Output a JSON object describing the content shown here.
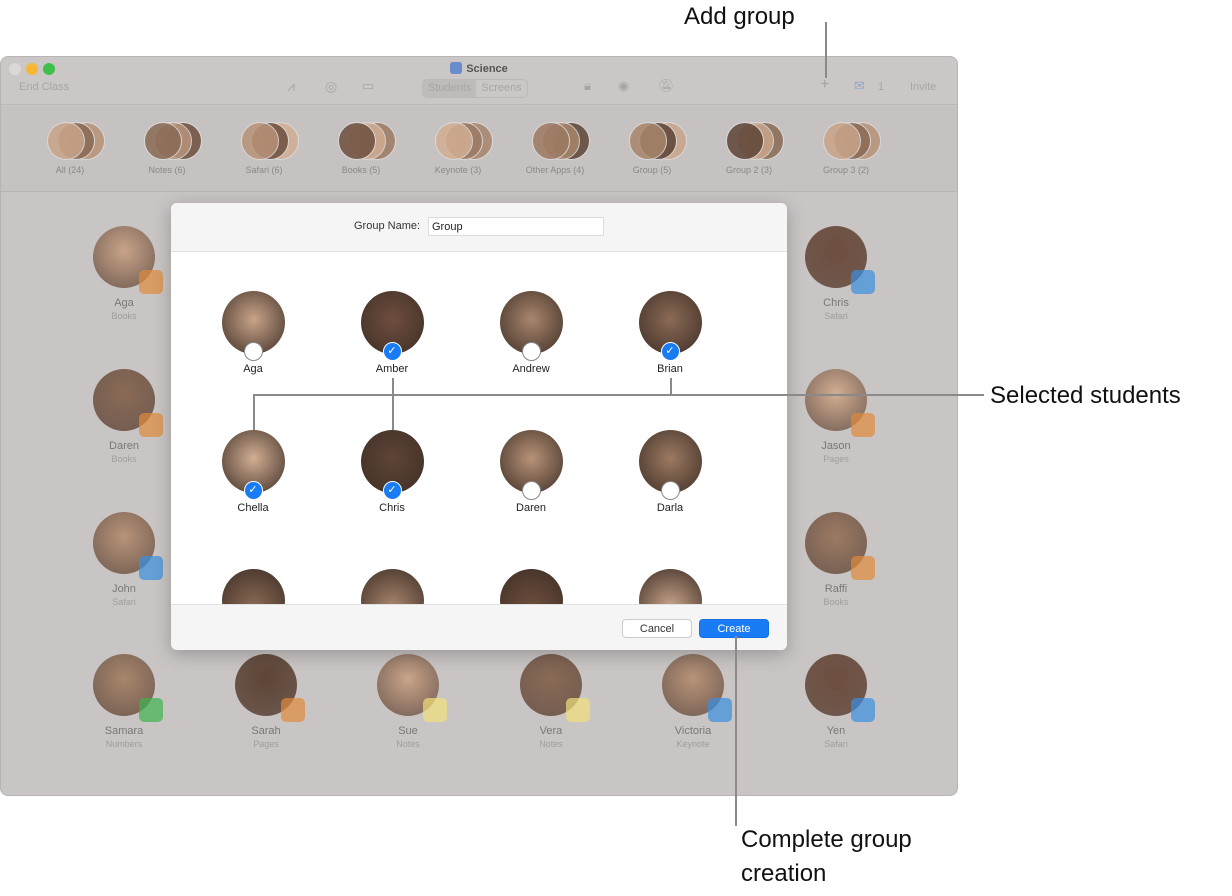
{
  "window": {
    "title": "Science",
    "toolbar": {
      "end_class": "End Class",
      "students_tab": "Students",
      "screens_tab": "Screens",
      "inbox_count": "1",
      "invite": "Invite"
    }
  },
  "groups": [
    {
      "label": "All (24)"
    },
    {
      "label": "Notes (6)"
    },
    {
      "label": "Safari (6)"
    },
    {
      "label": "Books (5)"
    },
    {
      "label": "Keynote (3)"
    },
    {
      "label": "Other Apps (4)"
    },
    {
      "label": "Group (5)"
    },
    {
      "label": "Group 2 (3)"
    },
    {
      "label": "Group 3 (2)"
    }
  ],
  "background_students": [
    {
      "name": "Aga",
      "app": "Books",
      "color": "#e08a3c"
    },
    {
      "name": "Daren",
      "app": "Books",
      "color": "#e08a3c"
    },
    {
      "name": "John",
      "app": "Safari",
      "color": "#3b8ee0"
    },
    {
      "name": "Chris",
      "app": "Safari",
      "color": "#3b8ee0"
    },
    {
      "name": "Jason",
      "app": "Pages",
      "color": "#e08a3c"
    },
    {
      "name": "Raffi",
      "app": "Books",
      "color": "#e08a3c"
    },
    {
      "name": "Samara",
      "app": "Numbers",
      "color": "#3fb34f"
    },
    {
      "name": "Sarah",
      "app": "Pages",
      "color": "#e08a3c"
    },
    {
      "name": "Sue",
      "app": "Notes",
      "color": "#f2e07a"
    },
    {
      "name": "Vera",
      "app": "Notes",
      "color": "#f2e07a"
    },
    {
      "name": "Victoria",
      "app": "Keynote",
      "color": "#3b8ee0"
    },
    {
      "name": "Yen",
      "app": "Safari",
      "color": "#3b8ee0"
    }
  ],
  "dialog": {
    "group_name_label": "Group Name:",
    "group_name_value": "Group",
    "cancel": "Cancel",
    "create": "Create",
    "students": [
      {
        "name": "Aga",
        "selected": false
      },
      {
        "name": "Amber",
        "selected": true
      },
      {
        "name": "Andrew",
        "selected": false
      },
      {
        "name": "Brian",
        "selected": true
      },
      {
        "name": "Chella",
        "selected": true
      },
      {
        "name": "Chris",
        "selected": true
      },
      {
        "name": "Daren",
        "selected": false
      },
      {
        "name": "Darla",
        "selected": false
      }
    ]
  },
  "callouts": {
    "add_group": "Add group",
    "selected_students": "Selected students",
    "complete": "Complete group creation"
  },
  "colors": {
    "accent": "#1a7cf5"
  }
}
